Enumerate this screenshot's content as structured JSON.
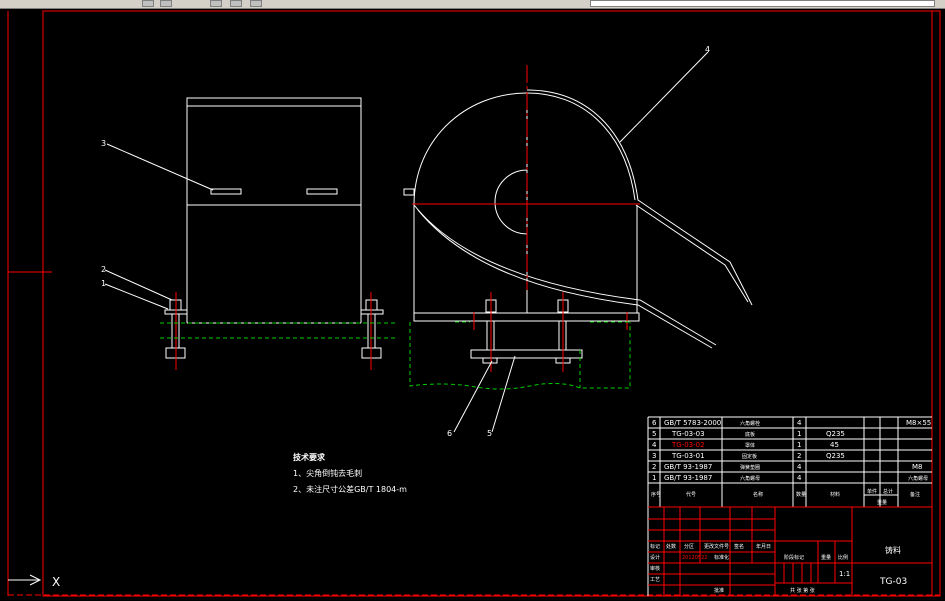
{
  "toolbar": {
    "icons": [
      "open-icon",
      "save-icon",
      "layer-icon",
      "properties-icon",
      "zoom-icon"
    ]
  },
  "colors": {
    "background": "#000000",
    "geometry": "#ffffff",
    "frame": "#ff0000",
    "hidden": "#00cc00",
    "text": "#ffffff"
  },
  "balloons": {
    "b1": "1",
    "b2": "2",
    "b3": "3",
    "b4": "4",
    "b5": "5",
    "b6": "6"
  },
  "tech_requirements": {
    "heading": "技术要求",
    "line1": "1、尖角倒钝去毛刺",
    "line2": "2、未注尺寸公差GB/T 1804-m"
  },
  "bom": {
    "rows": [
      {
        "no": "6",
        "code": "GB/T 5783-2000",
        "name": "六角螺栓",
        "qty": "4",
        "material": "",
        "note": "M8×55"
      },
      {
        "no": "5",
        "code": "TG-03-03",
        "name": "底板",
        "qty": "1",
        "material": "Q235",
        "note": ""
      },
      {
        "no": "4",
        "code": "TG-03-02",
        "name": "罩体",
        "qty": "1",
        "material": "45",
        "note": ""
      },
      {
        "no": "3",
        "code": "TG-03-01",
        "name": "固定板",
        "qty": "2",
        "material": "Q235",
        "note": ""
      },
      {
        "no": "2",
        "code": "GB/T 93-1987",
        "name": "弹簧垫圈",
        "qty": "4",
        "material": "",
        "note": "M8"
      },
      {
        "no": "1",
        "code": "GB/T 93-1987",
        "name": "六角螺母",
        "qty": "4",
        "material": "",
        "note": "六角螺母"
      }
    ],
    "header": {
      "no": "序号",
      "code": "代号",
      "name": "名称",
      "qty": "数量",
      "material": "材料",
      "unit_weight": "单件",
      "total_weight": "总计",
      "weight": "重量",
      "note": "备注"
    }
  },
  "title_block": {
    "drawing_name": "铸料",
    "drawing_number": "TG-03",
    "scale_label": "比例",
    "scale_value": "1:1",
    "stage_label": "阶段标记",
    "weight_label": "重量",
    "row_labels": [
      "标记",
      "处数",
      "分区",
      "更改文件号",
      "签名",
      "年月日"
    ],
    "design": "设计",
    "design_value": "20120522",
    "standard": "标准化",
    "review": "审核",
    "process": "工艺",
    "approve": "批准",
    "sheet": "共 张 第 张"
  },
  "ucs": {
    "x_label": "X"
  }
}
